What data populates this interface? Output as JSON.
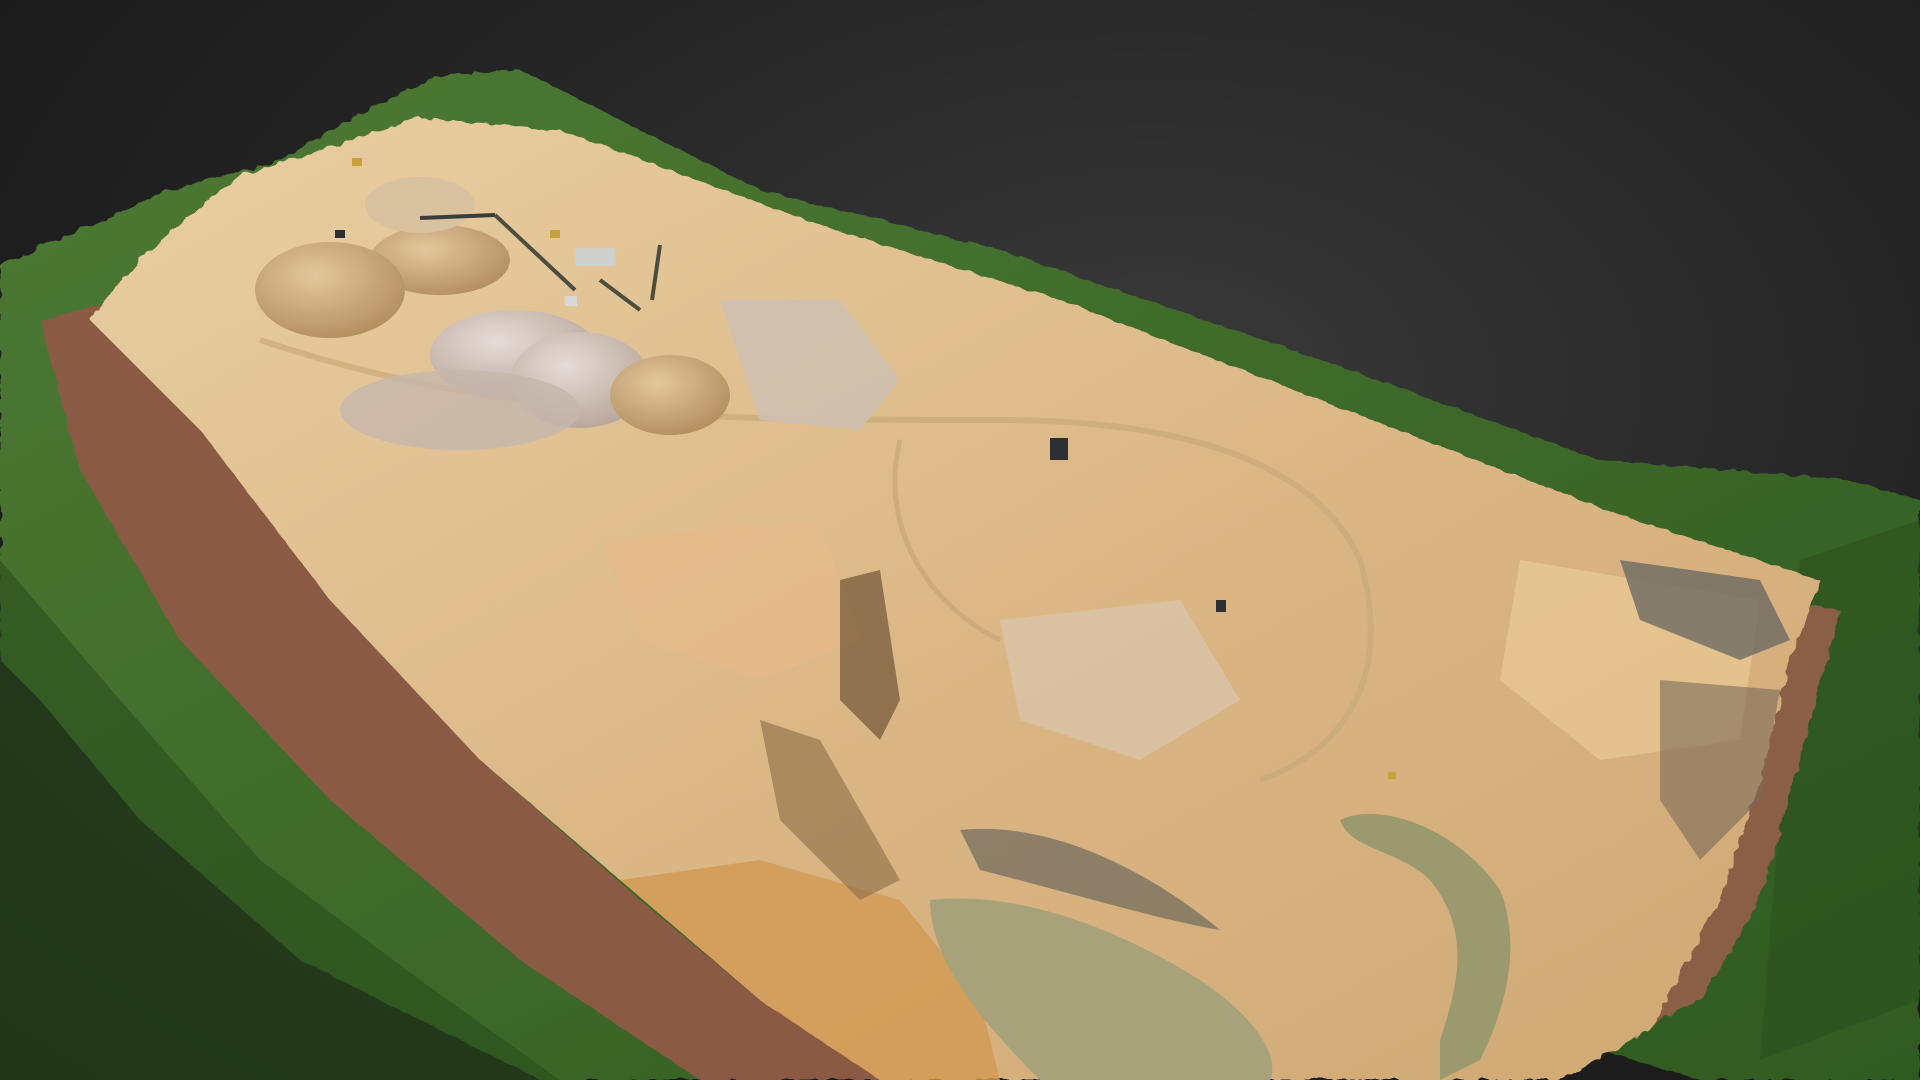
{
  "scene": {
    "subject": "",
    "colors": {
      "background": "#1c1c1c",
      "forest": "#3f6a2a",
      "forest_dark": "#244417",
      "sand": "#dcb887",
      "sand_light": "#ecd2a6",
      "sand_dark": "#b98f5d",
      "stockpile": "#c9b9b0",
      "bank_red": "#8a5a45",
      "water": "#9b9a6f",
      "machinery_dark": "#2c2f33",
      "machinery_yellow": "#c7a23a"
    }
  }
}
